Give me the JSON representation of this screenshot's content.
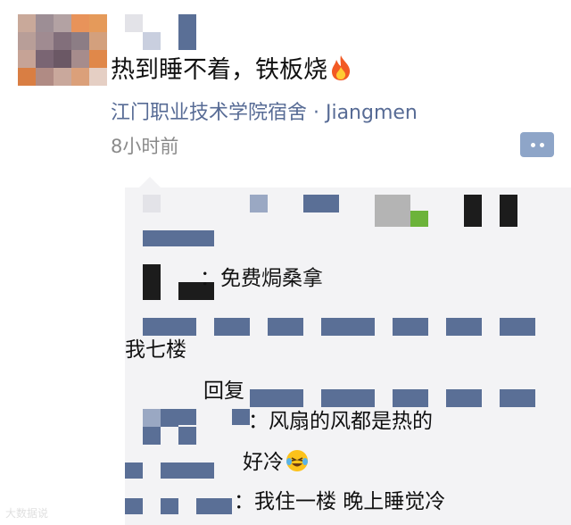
{
  "post": {
    "text": "热到睡不着，铁板烧",
    "location": "江门职业技术学院宿舍 · Jiangmen",
    "time": "8小时前",
    "more_button_icon": "more-dots-icon"
  },
  "comments": [
    {
      "text": "：免费焗桑拿"
    },
    {
      "text": "我七楼"
    },
    {
      "text": "回复"
    },
    {
      "text": "：风扇的风都是热的"
    },
    {
      "text": "好冷"
    },
    {
      "text": "：我住一楼 晚上睡觉冷"
    }
  ],
  "watermark": "大数据说",
  "colors": {
    "link": "#576b95",
    "panel": "#f3f3f5",
    "time": "#8a8a8a"
  }
}
